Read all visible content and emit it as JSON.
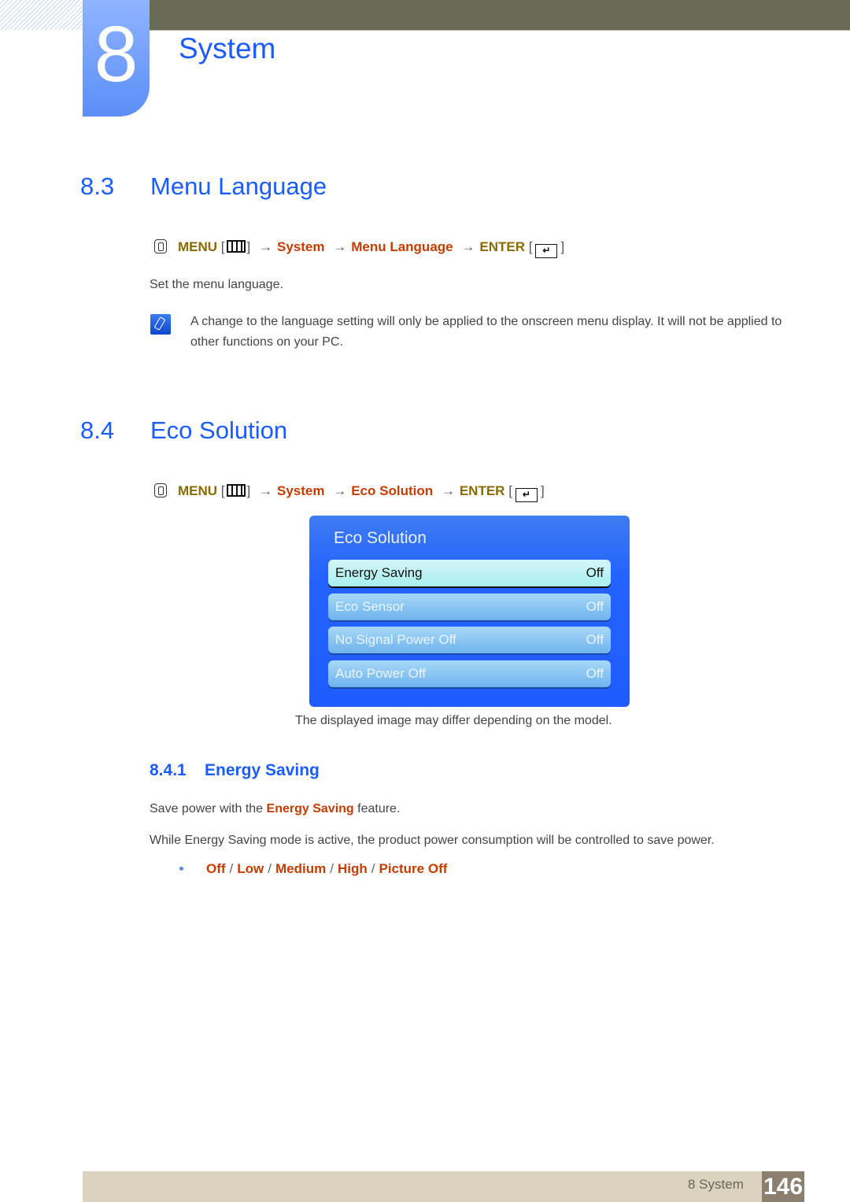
{
  "chapter": {
    "number": "8",
    "title": "System"
  },
  "section_menu_language": {
    "number": "8.3",
    "title": "Menu Language",
    "path": {
      "menu": "MENU",
      "system": "System",
      "item": "Menu Language",
      "enter": "ENTER"
    },
    "description": "Set the menu language.",
    "note": "A change to the language setting will only be applied to the onscreen menu display. It will not be applied to other functions on your PC."
  },
  "section_eco": {
    "number": "8.4",
    "title": "Eco Solution",
    "path": {
      "menu": "MENU",
      "system": "System",
      "item": "Eco Solution",
      "enter": "ENTER"
    },
    "osd": {
      "title": "Eco Solution",
      "rows": [
        {
          "label": "Energy Saving",
          "value": "Off",
          "selected": true
        },
        {
          "label": "Eco Sensor",
          "value": "Off"
        },
        {
          "label": "No Signal Power Off",
          "value": "Off"
        },
        {
          "label": "Auto Power Off",
          "value": "Off"
        }
      ]
    },
    "caption": "The displayed image may differ depending on the model."
  },
  "subsection_energy": {
    "number": "8.4.1",
    "title": "Energy Saving",
    "line1_pre": "Save power with the ",
    "line1_bold": "Energy Saving",
    "line1_post": " feature.",
    "line2": "While Energy Saving mode is active, the product power consumption will be controlled to save power.",
    "options": [
      "Off",
      "Low",
      "Medium",
      "High",
      "Picture Off"
    ],
    "option_separator": "/"
  },
  "footer": {
    "label": "8 System",
    "page": "146"
  },
  "arrow": "→",
  "colors": {
    "heading_blue": "#1a5cff",
    "menu_olive": "#8a6a00",
    "item_red": "#c43c00"
  }
}
